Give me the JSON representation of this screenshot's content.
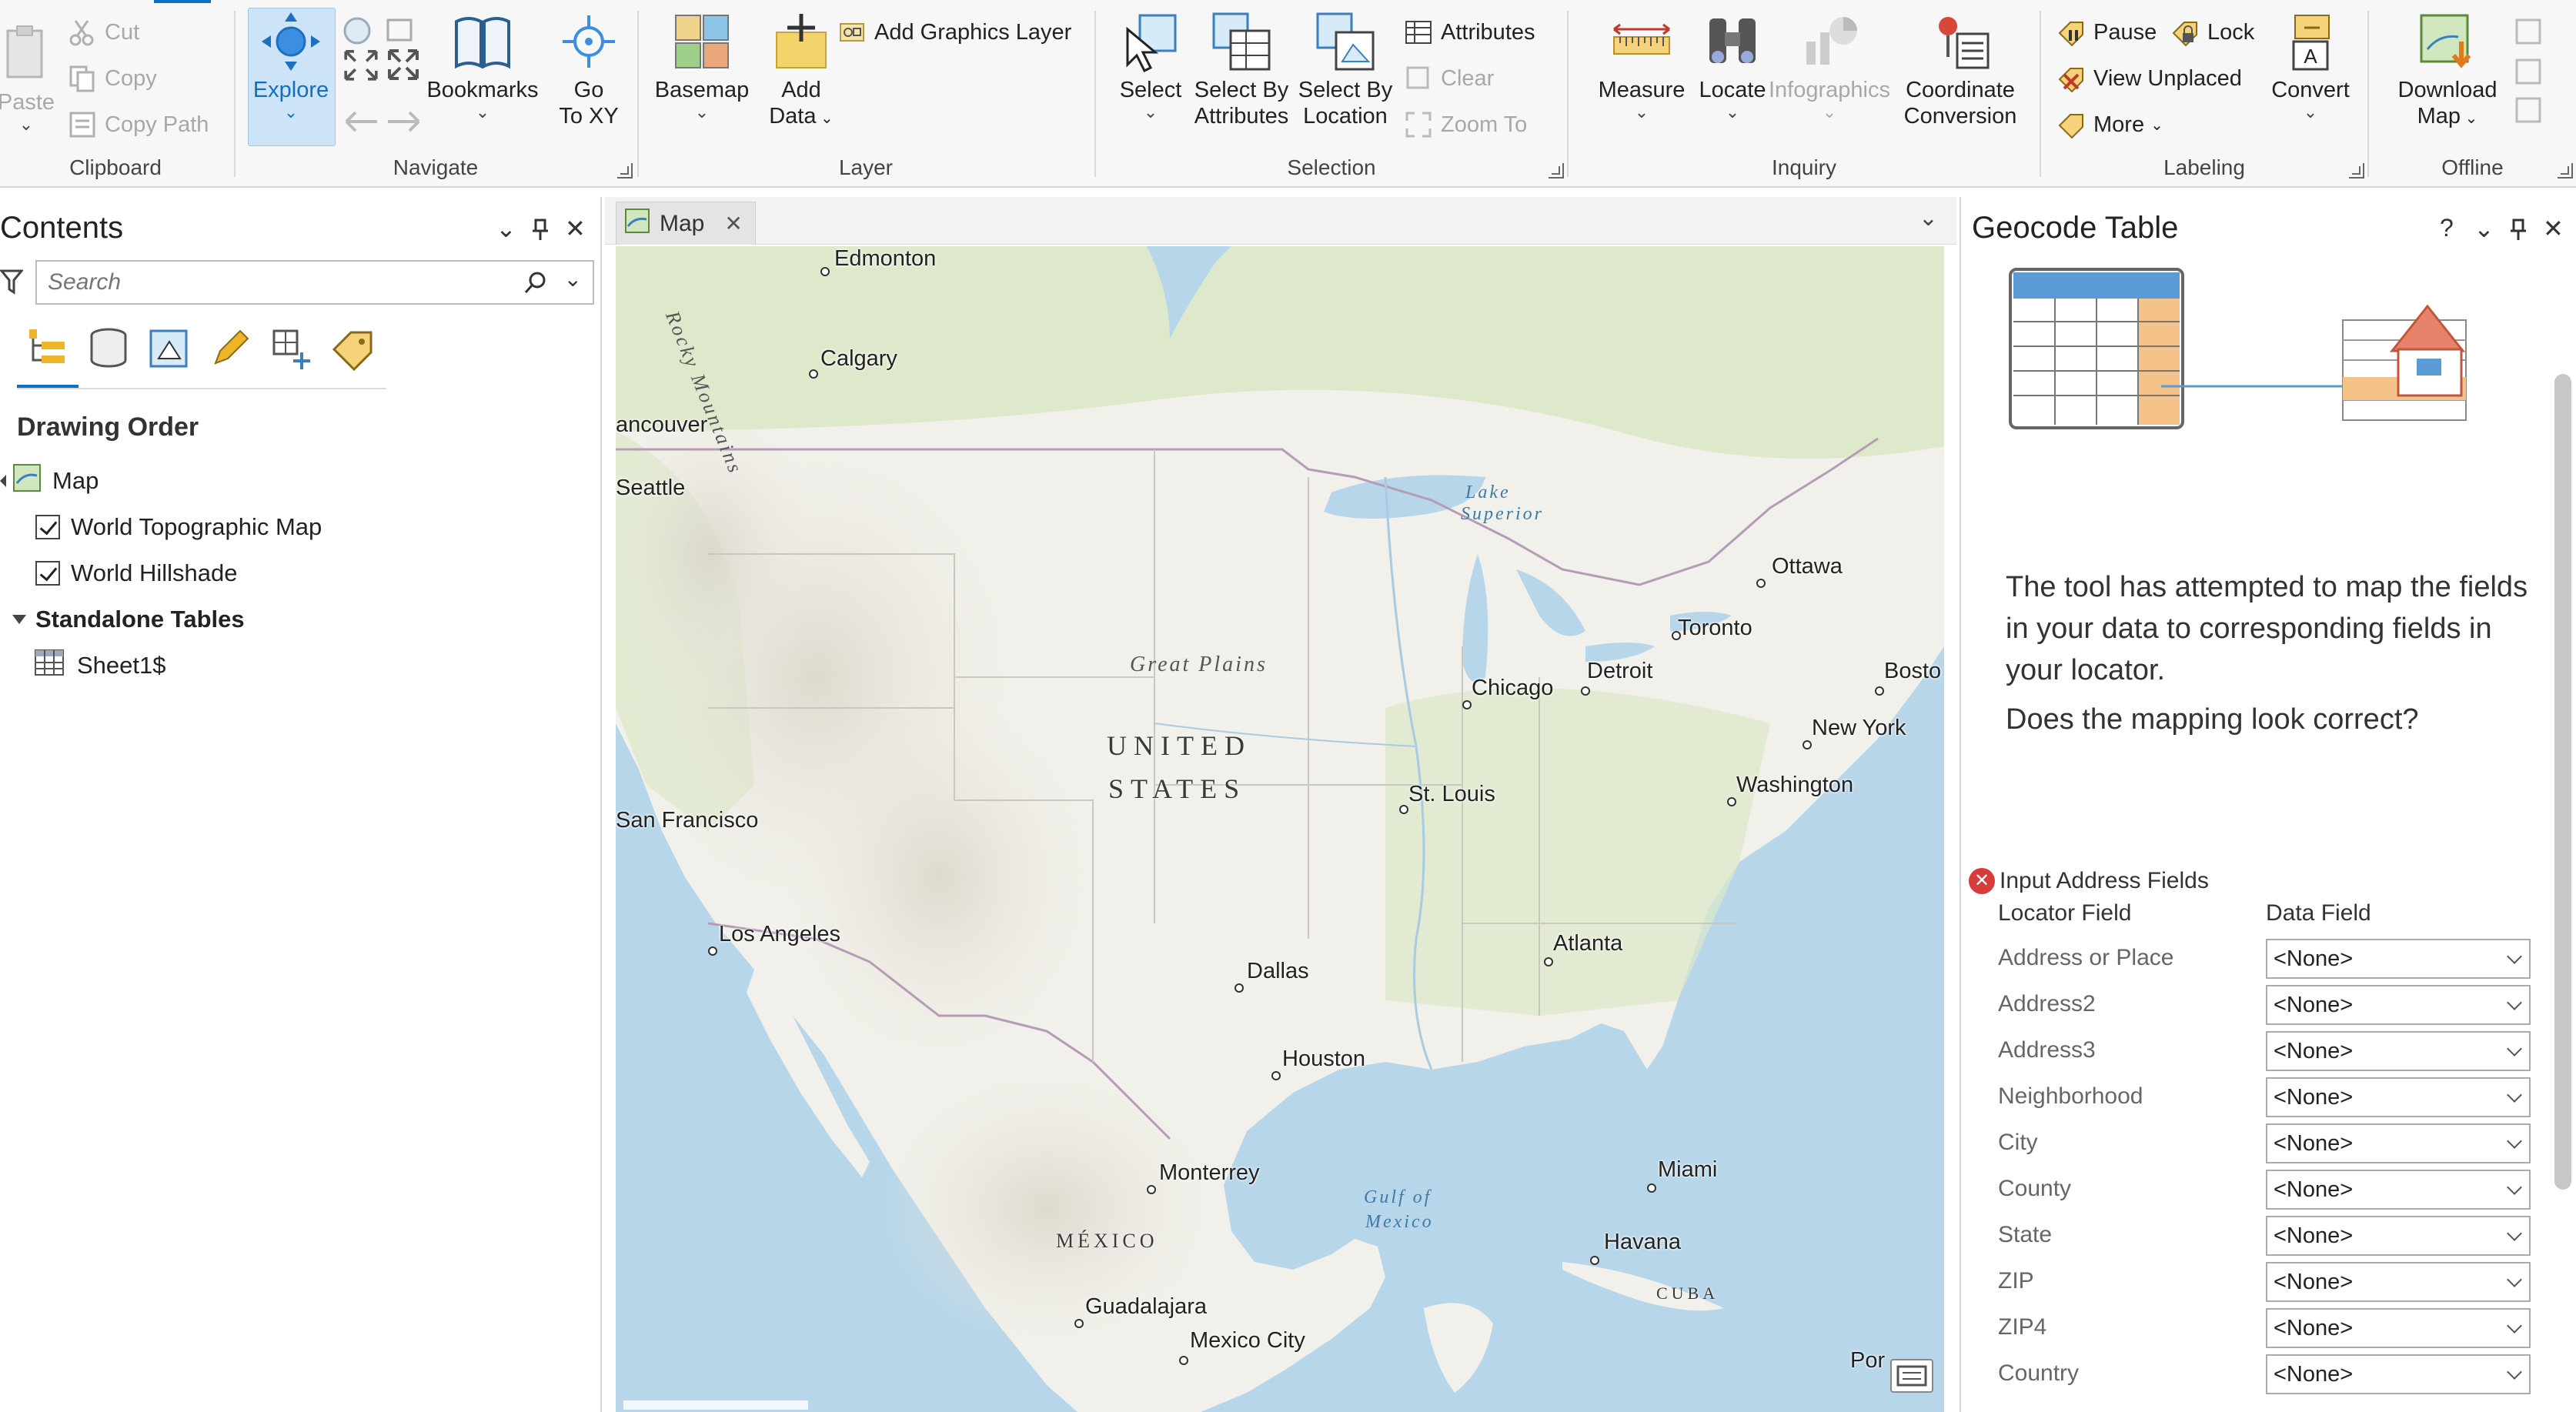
{
  "ribbon": {
    "clipboard": {
      "label": "Clipboard",
      "paste": "Paste",
      "cut": "Cut",
      "copy": "Copy",
      "copy_path": "Copy Path"
    },
    "navigate": {
      "label": "Navigate",
      "explore": "Explore",
      "bookmarks": "Bookmarks",
      "go_to_xy_1": "Go",
      "go_to_xy_2": "To XY"
    },
    "layer": {
      "label": "Layer",
      "basemap": "Basemap",
      "add_data_1": "Add",
      "add_data_2": "Data",
      "add_graphics_layer": "Add Graphics Layer"
    },
    "selection": {
      "label": "Selection",
      "select": "Select",
      "select_by_attributes_1": "Select By",
      "select_by_attributes_2": "Attributes",
      "select_by_location_1": "Select By",
      "select_by_location_2": "Location",
      "attributes": "Attributes",
      "clear": "Clear",
      "zoom_to": "Zoom To"
    },
    "inquiry": {
      "label": "Inquiry",
      "measure": "Measure",
      "locate": "Locate",
      "infographics": "Infographics",
      "coordinate_conversion_1": "Coordinate",
      "coordinate_conversion_2": "Conversion"
    },
    "labeling": {
      "label": "Labeling",
      "pause": "Pause",
      "lock": "Lock",
      "view_unplaced": "View Unplaced",
      "more": "More",
      "convert": "Convert"
    },
    "offline": {
      "label": "Offline",
      "download_map_1": "Download",
      "download_map_2": "Map"
    }
  },
  "contents": {
    "title": "Contents",
    "search_placeholder": "Search",
    "drawing_order": "Drawing Order",
    "map": "Map",
    "layers": [
      "World Topographic Map",
      "World Hillshade"
    ],
    "standalone_tables": "Standalone Tables",
    "table": "Sheet1$"
  },
  "map_tab": {
    "label": "Map"
  },
  "map_labels": {
    "cities": [
      {
        "name": "Edmonton"
      },
      {
        "name": "Calgary"
      },
      {
        "name": "ancouver"
      },
      {
        "name": "Seattle"
      },
      {
        "name": "Ottawa"
      },
      {
        "name": "Toronto"
      },
      {
        "name": "Detroit"
      },
      {
        "name": "Chicago"
      },
      {
        "name": "Bosto"
      },
      {
        "name": "New York"
      },
      {
        "name": "Washington"
      },
      {
        "name": "St. Louis"
      },
      {
        "name": "San Francisco"
      },
      {
        "name": "Los Angeles"
      },
      {
        "name": "Atlanta"
      },
      {
        "name": "Dallas"
      },
      {
        "name": "Houston"
      },
      {
        "name": "Monterrey"
      },
      {
        "name": "Miami"
      },
      {
        "name": "Havana"
      },
      {
        "name": "Guadalajara"
      },
      {
        "name": "Mexico City"
      },
      {
        "name": "Por"
      }
    ],
    "countries": [
      "UNITED",
      "STATES",
      "MÉXICO",
      "CUBA"
    ],
    "regions": [
      "Great Plains",
      "Rocky Mountains"
    ],
    "water": [
      "Lake",
      "Superior",
      "Gulf of",
      "Mexico"
    ]
  },
  "geocode": {
    "title": "Geocode Table",
    "help": "?",
    "message": "The tool has attempted to map the fields in your data to corresponding fields in your locator.",
    "question": "Does the mapping look correct?",
    "fields_title": "Input Address Fields",
    "col_locator": "Locator Field",
    "col_data": "Data Field",
    "rows": [
      {
        "field": "Address or Place",
        "value": "<None>"
      },
      {
        "field": "Address2",
        "value": "<None>"
      },
      {
        "field": "Address3",
        "value": "<None>"
      },
      {
        "field": "Neighborhood",
        "value": "<None>"
      },
      {
        "field": "City",
        "value": "<None>"
      },
      {
        "field": "County",
        "value": "<None>"
      },
      {
        "field": "State",
        "value": "<None>"
      },
      {
        "field": "ZIP",
        "value": "<None>"
      },
      {
        "field": "ZIP4",
        "value": "<None>"
      },
      {
        "field": "Country",
        "value": "<None>"
      }
    ]
  },
  "colors": {
    "accent": "#0e70c0",
    "selected_bg": "#cde3f7",
    "error": "#d83b3b",
    "land": "#f1f0ea",
    "forest": "#dbe8c8",
    "water": "#b7d6ea"
  }
}
